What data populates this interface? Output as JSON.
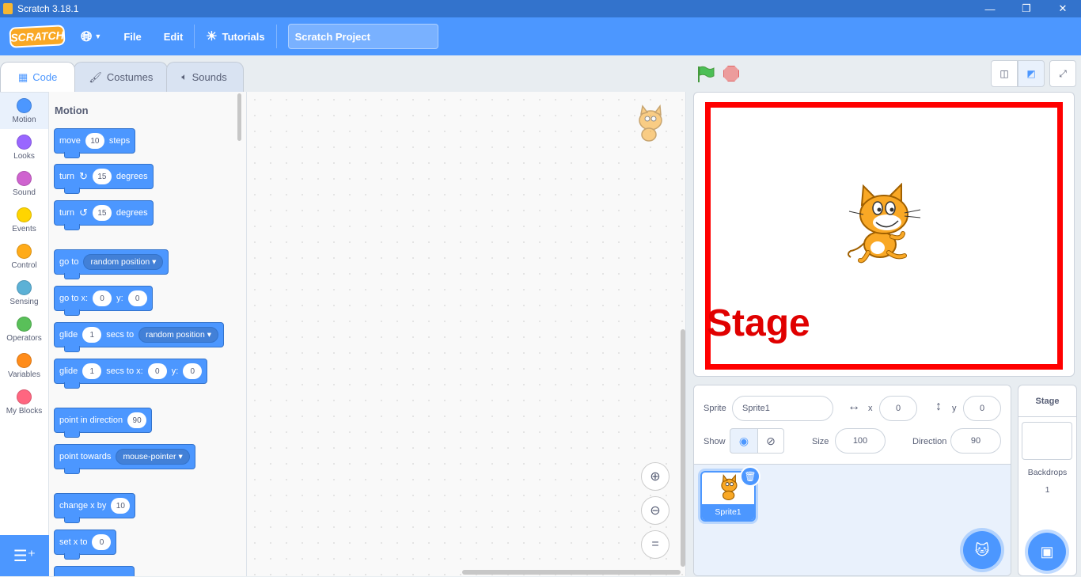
{
  "window": {
    "title": "Scratch 3.18.1",
    "controls": [
      "minimize-icon",
      "restore-icon",
      "close-icon"
    ]
  },
  "menubar": {
    "logo": "SCRATCH",
    "file": "File",
    "edit": "Edit",
    "tutorials": "Tutorials",
    "project_title": "Scratch Project"
  },
  "tabs": [
    {
      "label": "Code",
      "icon": "code-icon",
      "active": true
    },
    {
      "label": "Costumes",
      "icon": "brush-icon",
      "active": false
    },
    {
      "label": "Sounds",
      "icon": "speaker-icon",
      "active": false
    }
  ],
  "categories": [
    {
      "label": "Motion",
      "color": "#4c97ff"
    },
    {
      "label": "Looks",
      "color": "#9966ff"
    },
    {
      "label": "Sound",
      "color": "#cf63cf"
    },
    {
      "label": "Events",
      "color": "#ffd500"
    },
    {
      "label": "Control",
      "color": "#ffab19"
    },
    {
      "label": "Sensing",
      "color": "#5cb1d6"
    },
    {
      "label": "Operators",
      "color": "#59c059"
    },
    {
      "label": "Variables",
      "color": "#ff8c1a"
    },
    {
      "label": "My Blocks",
      "color": "#ff6680"
    }
  ],
  "palette": {
    "title": "Motion",
    "blocks": {
      "move": {
        "a": "move",
        "v": "10",
        "b": "steps"
      },
      "turn_right": {
        "a": "turn",
        "v": "15",
        "b": "degrees"
      },
      "turn_left": {
        "a": "turn",
        "v": "15",
        "b": "degrees"
      },
      "goto": {
        "a": "go to",
        "dd": "random position"
      },
      "gotoxy": {
        "a": "go to x:",
        "x": "0",
        "b": "y:",
        "y": "0"
      },
      "glide_to": {
        "a": "glide",
        "v": "1",
        "b": "secs to",
        "dd": "random position"
      },
      "glide_xy": {
        "a": "glide",
        "v": "1",
        "b": "secs to x:",
        "x": "0",
        "c": "y:",
        "y": "0"
      },
      "point_dir": {
        "a": "point in direction",
        "v": "90"
      },
      "point_towards": {
        "a": "point towards",
        "dd": "mouse-pointer"
      },
      "change_x": {
        "a": "change x by",
        "v": "10"
      },
      "set_x": {
        "a": "set x to",
        "v": "0"
      }
    }
  },
  "zoom": [
    "zoom-in-icon",
    "zoom-out-icon",
    "zoom-reset-icon"
  ],
  "stage": {
    "label": "Stage"
  },
  "sprite_info": {
    "sprite_label": "Sprite",
    "sprite_name": "Sprite1",
    "x_label": "x",
    "x_value": "0",
    "y_label": "y",
    "y_value": "0",
    "show_label": "Show",
    "size_label": "Size",
    "size_value": "100",
    "direction_label": "Direction",
    "direction_value": "90"
  },
  "sprites": [
    {
      "name": "Sprite1",
      "selected": true
    }
  ],
  "stage_pane": {
    "title": "Stage",
    "backdrops_label": "Backdrops",
    "backdrops_count": "1"
  }
}
